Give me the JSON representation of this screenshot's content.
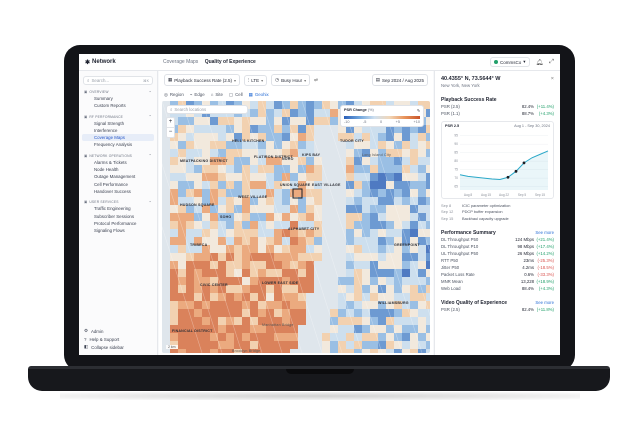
{
  "app": {
    "brand": "Network",
    "breadcrumb_parent": "Coverage Maps",
    "breadcrumb_current": "Quality of Experience",
    "org": "CommsCo"
  },
  "sidebar": {
    "search_placeholder": "Search...",
    "search_shortcut": "⌘K",
    "sections": [
      {
        "title": "OVERVIEW",
        "items": [
          "Summary",
          "Custom Reports"
        ]
      },
      {
        "title": "RF PERFORMANCE",
        "items": [
          "Signal Strength",
          "Interference",
          "Coverage Maps",
          "Frequency Analysis"
        ],
        "active": "Coverage Maps"
      },
      {
        "title": "NETWORK OPERATIONS",
        "items": [
          "Alarms & Tickets",
          "Node Health",
          "Outage Management",
          "Cell Performance",
          "Handover Success"
        ]
      },
      {
        "title": "USER SERVICES",
        "items": [
          "Traffic Engineering",
          "Subscriber Sessions",
          "Protocol Performance",
          "Signaling Flows"
        ]
      }
    ],
    "bottom": [
      "Admin",
      "Help & Support",
      "Collapse sidebar"
    ]
  },
  "toolbar": {
    "metric": "Playback Success Rate (2.5)",
    "tech": "LTE",
    "granularity": "Busy Hour",
    "date_range": "Sep 2024 / Aug 2025"
  },
  "modes": [
    "Region",
    "Edge",
    "Site",
    "Cell",
    "Geohix"
  ],
  "active_mode": "Geohix",
  "map": {
    "search_placeholder": "Search locations",
    "legend_title": "PSR Change",
    "legend_unit": "(%)",
    "legend_ticks": [
      "-10",
      "-5",
      "0",
      "+5",
      "+10"
    ],
    "scale": "2 km",
    "places": [
      {
        "name": "HELL'S KITCHEN",
        "id": "hk"
      },
      {
        "name": "MEATPACKING DISTRICT",
        "id": "mp"
      },
      {
        "name": "FLATIRON DISTRICT",
        "id": "fd"
      },
      {
        "name": "NOHO",
        "id": "nh"
      },
      {
        "name": "UNION SQUARE",
        "id": "us"
      },
      {
        "name": "EAST VILLAGE",
        "id": "ev"
      },
      {
        "name": "WEST VILLAGE",
        "id": "wv"
      },
      {
        "name": "HUDSON SQUARE",
        "id": "hs"
      },
      {
        "name": "SOHO",
        "id": "so"
      },
      {
        "name": "TRIBECA",
        "id": "tb"
      },
      {
        "name": "CIVIC CENTER",
        "id": "cc"
      },
      {
        "name": "LOWER EAST SIDE",
        "id": "les"
      },
      {
        "name": "ALPHABET CITY",
        "id": "ac"
      },
      {
        "name": "WILLIAMSBURG",
        "id": "wb"
      },
      {
        "name": "GREENPOINT",
        "id": "gp"
      },
      {
        "name": "FINANCIAL DISTRICT",
        "id": "fin"
      },
      {
        "name": "KIPS BAY",
        "id": "kb"
      },
      {
        "name": "TUDOR CITY",
        "id": "tc"
      },
      {
        "name": "Brooklyn Bridge",
        "id": "bb"
      },
      {
        "name": "Manhattan Bridge",
        "id": "mb"
      },
      {
        "name": "Long Island City",
        "id": "lic"
      }
    ]
  },
  "panel": {
    "coords": "40.4355° N, 73.5644° W",
    "city": "New York, New York",
    "psr_title": "Playback Success Rate",
    "psr_rows": [
      {
        "label": "PSR (2.5)",
        "value": "82.4%",
        "delta": "(+11.4%)"
      },
      {
        "label": "PSR (1.1)",
        "value": "88.7%",
        "delta": "(+4.3%)"
      }
    ],
    "chart": {
      "title": "PSR 2.5",
      "range": "Aug 1 - Sep 30, 2024"
    },
    "events": [
      {
        "date": "Sep 8",
        "text": "ICIC parameter optimization"
      },
      {
        "date": "Sep 12",
        "text": "PDCP buffer expansion"
      },
      {
        "date": "Sep 15",
        "text": "Backhaul capacity upgrade"
      }
    ],
    "perf_title": "Performance Summary",
    "perf_link": "See more",
    "perf_rows": [
      {
        "label": "DL Throughput P50",
        "value": "124 Mbps",
        "delta": "(+21.4%)"
      },
      {
        "label": "DL Throughput P10",
        "value": "98 Mbps",
        "delta": "(+17.4%)"
      },
      {
        "label": "UL Throughput P50",
        "value": "26 Mbps",
        "delta": "(+14.2%)"
      },
      {
        "label": "RTT P50",
        "value": "23ms",
        "delta": "(-25.3%)"
      },
      {
        "label": "Jitter P50",
        "value": "4.2ms",
        "delta": "(-18.5%)"
      },
      {
        "label": "Packet Loss Rate",
        "value": "0.6%",
        "delta": "(-33.3%)"
      },
      {
        "label": "MNR Mean",
        "value": "13,228",
        "delta": "(+18.9%)"
      },
      {
        "label": "Web Load",
        "value": "88.4%",
        "delta": "(+4.3%)"
      }
    ],
    "vqe_title": "Video Quality of Experience",
    "vqe_link": "See more",
    "vqe_rows": [
      {
        "label": "PSR (2.5)",
        "value": "82.4%",
        "delta": "(+11.8%)"
      }
    ]
  },
  "chart_data": {
    "type": "line",
    "title": "PSR 2.5",
    "x": [
      "Aug 1",
      "Aug 7",
      "Aug 14",
      "Aug 21",
      "Aug 28",
      "Sep 4",
      "Sep 8",
      "Sep 12",
      "Sep 15",
      "Sep 20",
      "Sep 25",
      "Sep 30"
    ],
    "values": [
      72,
      71,
      70.5,
      70,
      69.5,
      69.2,
      70.5,
      74,
      79,
      82,
      84,
      86
    ],
    "xticks": [
      "Aug 8",
      "Aug 15",
      "Aug 22",
      "Sep 5",
      "Sep 15"
    ],
    "yticks": [
      "95",
      "90",
      "85",
      "80",
      "75",
      "70",
      "65"
    ],
    "ylim": [
      63,
      96
    ],
    "markers": [
      "Sep 8",
      "Sep 12",
      "Sep 15"
    ]
  }
}
